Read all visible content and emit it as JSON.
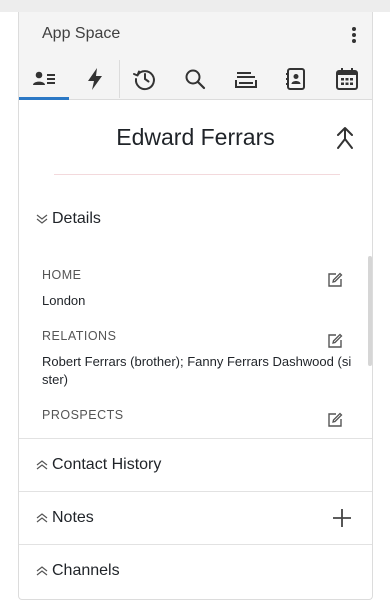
{
  "header": {
    "app_title": "App Space",
    "tabs": [
      {
        "name": "contact-card",
        "icon": "contact-card-icon",
        "active": true
      },
      {
        "name": "activity",
        "icon": "lightning-icon",
        "active": false
      },
      {
        "name": "history",
        "icon": "history-icon",
        "active": false
      },
      {
        "name": "search",
        "icon": "search-icon",
        "active": false
      },
      {
        "name": "inbox",
        "icon": "inbox-icon",
        "active": false
      },
      {
        "name": "address-book",
        "icon": "address-book-icon",
        "active": false
      },
      {
        "name": "calendar",
        "icon": "calendar-icon",
        "active": false
      }
    ]
  },
  "contact": {
    "name": "Edward Ferrars"
  },
  "sections": {
    "details": {
      "label": "Details",
      "expanded": true,
      "fields": [
        {
          "label": "HOME",
          "value": "London"
        },
        {
          "label": "RELATIONS",
          "value": "Robert Ferrars (brother); Fanny Ferrars Dashwood (sister)"
        },
        {
          "label": "PROSPECTS",
          "value": ""
        }
      ]
    },
    "contact_history": {
      "label": "Contact History",
      "expanded": false
    },
    "notes": {
      "label": "Notes",
      "expanded": false
    },
    "channels": {
      "label": "Channels",
      "expanded": false
    }
  },
  "colors": {
    "accent": "#2b78c5",
    "header_bg": "#f4f4f4",
    "divider": "#e2e2e2"
  }
}
